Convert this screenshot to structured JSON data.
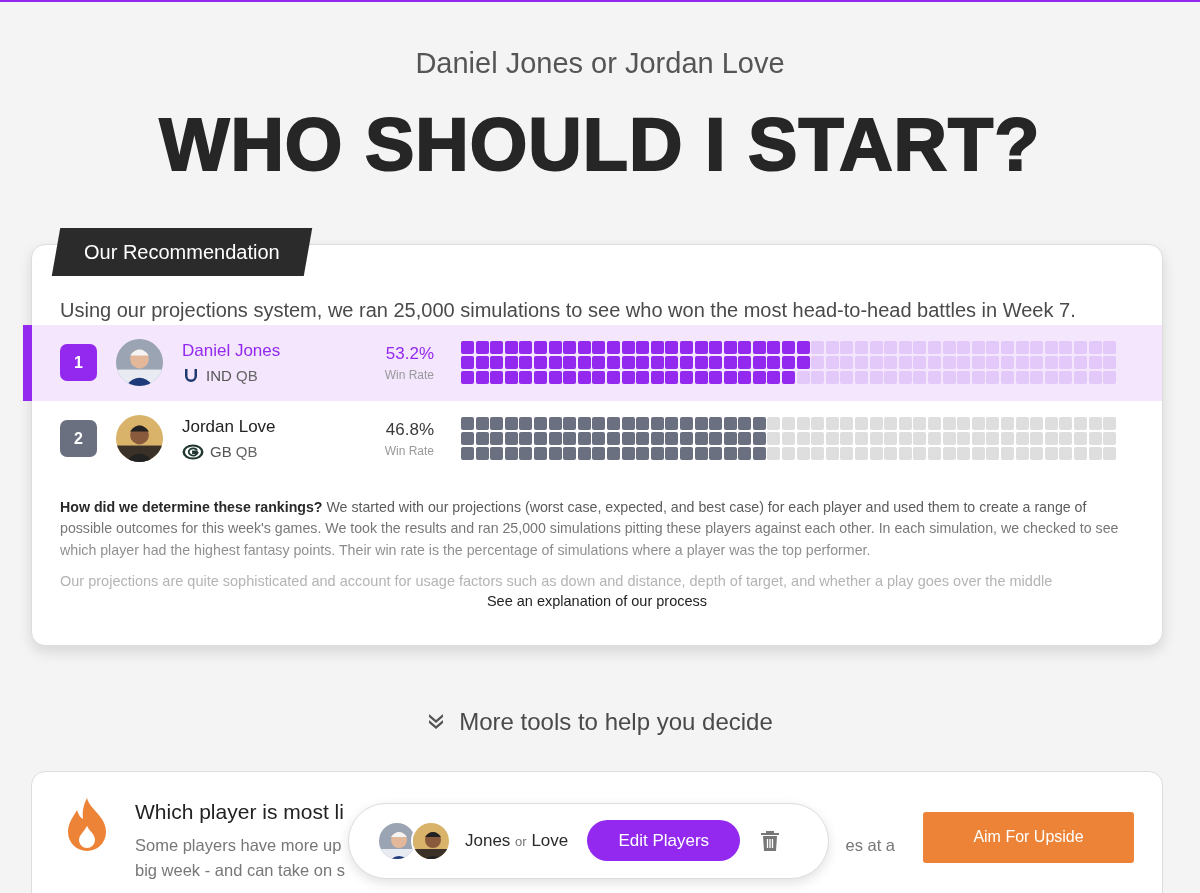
{
  "header": {
    "matchup": "Daniel Jones or Jordan Love",
    "title": "WHO SHOULD I START?"
  },
  "recommendation": {
    "tag": "Our Recommendation",
    "intro": "Using our projections system, we ran 25,000 simulations to see who won the most head-to-head battles in Week 7.",
    "players": [
      {
        "rank": "1",
        "name": "Daniel Jones",
        "kind": "horseshoe",
        "team": "IND",
        "position": "QB",
        "win_rate": "53.2%",
        "win_label": "Win Rate",
        "selected": true
      },
      {
        "rank": "2",
        "name": "Jordan Love",
        "kind": "oval",
        "team": "GB",
        "position": "QB",
        "win_rate": "46.8%",
        "win_label": "Win Rate",
        "selected": false
      }
    ],
    "explanation": "**How did we determine these rankings?** We started with our projections (worst case, expected, and best case) for each player and used them to create a range of possible outcomes for this week's games. We took the results and ran 25,000 simulations pitting these players against each other. In each simulation, we checked to see which player had the highest fantasy points. Their win rate is the percentage of simulations where a player was the top performer.",
    "faded_text": "Our projections are quite sophisticated and account for usage factors such as down and distance, depth of target, and whether a play goes over the middle",
    "link": "See an explanation of our process"
  },
  "more_tools": {
    "label": "More tools to help you decide"
  },
  "tool_card": {
    "title": "Which player is most li",
    "description_start": "Some players have more up",
    "description_end": "es at a",
    "description_line2": "big week - and can take on s",
    "button": "Aim For Upside"
  },
  "compare_bar": {
    "name_a": "Jones",
    "joiner": "or",
    "name_b": "Love",
    "button": "Edit Players"
  }
}
